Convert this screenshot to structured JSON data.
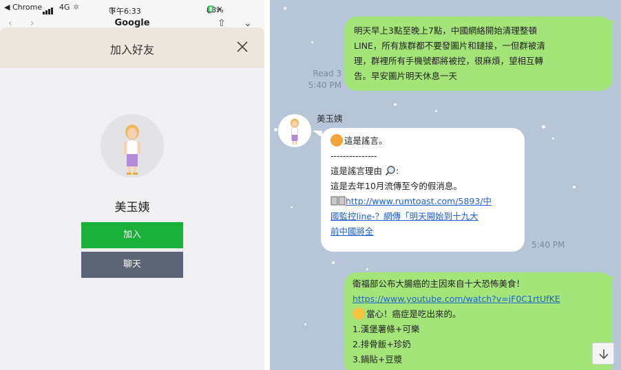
{
  "status_bar": {
    "carrier": "◀ Chrome",
    "network": "4G",
    "time": "下午6:33",
    "battery": "88%"
  },
  "browser": {
    "title": "Google"
  },
  "add_friend_modal": {
    "title": "加入好友",
    "friend_name": "美玉姨",
    "add_label": "加入",
    "chat_label": "聊天"
  },
  "chat": {
    "messages": [
      {
        "direction": "sent",
        "lines": [
          "明天早上3點至晚上7點，中國網絡開始清理整頓",
          "LINE，所有族群都不要發圖片和鏈接，一但群被清",
          "理，群裡所有手機號都將被控，很麻煩，望相互轉",
          "告。早安圖片明天休息一天"
        ],
        "read_label": "Read 3",
        "time": "5:40 PM"
      },
      {
        "direction": "received",
        "sender": "美玉姨",
        "line1": "這是謠言。",
        "separator": "---------------",
        "line3": "這是謠言理由",
        "line3_suffix": ":",
        "line4": " 這是去年10月流傳至今的假消息。",
        "link_lines": [
          "http://www.rumtoast.com/5893/中",
          "國監控line-？網傳「明天開始到十九大",
          "前中國將全"
        ],
        "time": "5:40 PM"
      },
      {
        "direction": "sent",
        "line1": "衛福部公布大腸癌的主因來自十大恐怖美食！",
        "link": "https://www.youtube.com/watch?v=jF0C1rtUfKE",
        "line3": "當心！癌症是吃出來的。",
        "list": [
          "1.漢堡薯條+可樂",
          "2.排骨飯+珍奶",
          "3.鍋貼+豆漿"
        ]
      }
    ]
  },
  "icons": {
    "close": "close-icon",
    "scroll_down": "arrow-down-icon",
    "magnifier": "magnifier-icon",
    "book": "book-icon"
  },
  "colors": {
    "line_green": "#1bb03a",
    "sent_bubble": "#a4e57a",
    "chat_background": "#b6c5d8",
    "link": "#1e5fd6"
  }
}
